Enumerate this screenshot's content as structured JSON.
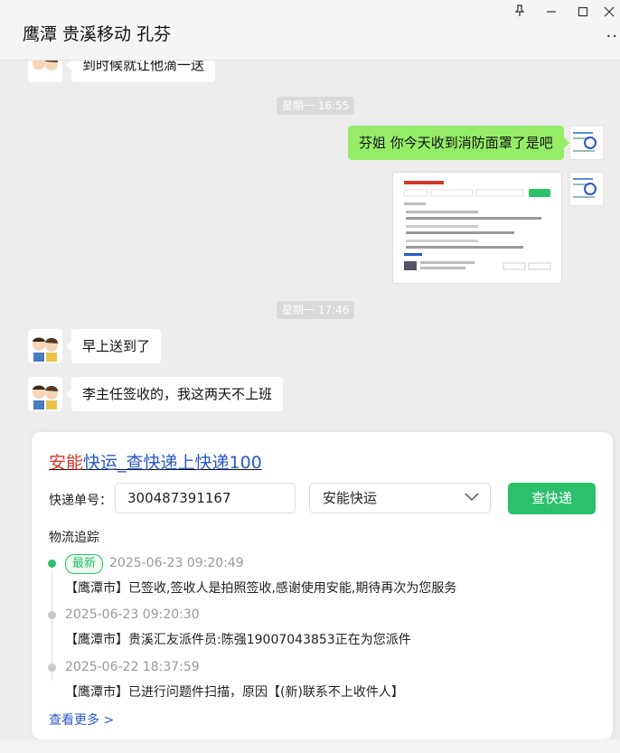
{
  "window": {
    "title": "鹰潭 贵溪移动 孔芬",
    "pin_icon": "pin-icon",
    "minimize_icon": "minimize-icon",
    "maximize_icon": "maximize-icon",
    "close_icon": "close-icon",
    "more_icon": "more-icon"
  },
  "chat": {
    "partial_message": "到时候就让他滴一送",
    "time1": "星期一 16:55",
    "my_message": "芬姐 你今天收到消防面罩了是吧",
    "time2": "星期一 17:46",
    "reply1": "早上送到了",
    "reply2": "李主任签收的，我这两天不上班"
  },
  "card": {
    "title_prefix": "安能",
    "title_suffix": "快运_查快递上快递100",
    "number_label": "快递单号：",
    "number_value": "300487391167",
    "company_value": "安能快运",
    "query_button": "查快递",
    "track_title": "物流追踪",
    "latest_badge": "最新",
    "events": [
      {
        "time": "2025-06-23 09:20:49",
        "text": "【鹰潭市】已签收,签收人是拍照签收,感谢使用安能,期待再次为您服务"
      },
      {
        "time": "2025-06-23 09:20:30",
        "text": "【鹰潭市】贵溪汇友派件员:陈强19007043853正在为您派件"
      },
      {
        "time": "2025-06-22 18:37:59",
        "text": "【鹰潭市】已进行问题件扫描，原因【(新)联系不上收件人】"
      }
    ],
    "see_more": "查看更多 >"
  },
  "colors": {
    "my_bubble": "#95ec69",
    "accent_green": "#2cc06a",
    "title_red": "#d4382c",
    "link_blue": "#2a59c6"
  }
}
